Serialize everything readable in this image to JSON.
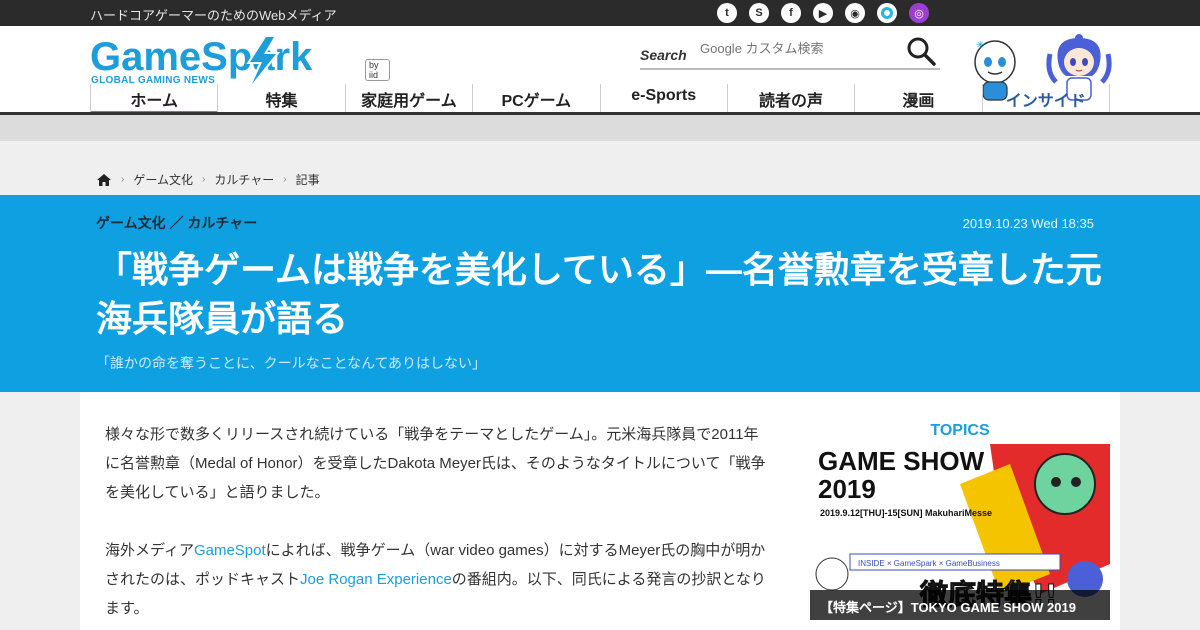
{
  "topbar": {
    "tagline": "ハードコアゲーマーのためのWebメディア",
    "social": [
      {
        "name": "twitter-icon",
        "glyph": "t"
      },
      {
        "name": "steam-icon",
        "glyph": "S"
      },
      {
        "name": "facebook-icon",
        "glyph": "f"
      },
      {
        "name": "youtube-icon",
        "glyph": "▶"
      },
      {
        "name": "rss-icon",
        "glyph": "◉"
      },
      {
        "name": "alexa-icon",
        "glyph": ""
      },
      {
        "name": "podcast-icon",
        "glyph": "◎"
      }
    ]
  },
  "logo": {
    "word": "GameSpark",
    "sub": "GLOBAL GAMING NEWS",
    "byline": "by iid"
  },
  "search": {
    "label": "Search",
    "placeholder": "Google カスタム検索"
  },
  "nav": [
    {
      "label": "ホーム",
      "active": true
    },
    {
      "label": "特集",
      "active": false
    },
    {
      "label": "家庭用ゲーム",
      "active": false
    },
    {
      "label": "PCゲーム",
      "active": false
    },
    {
      "label": "e-Sports",
      "active": false
    },
    {
      "label": "読者の声",
      "active": false
    },
    {
      "label": "漫画",
      "active": false
    },
    {
      "label": "インサイド",
      "active": false
    }
  ],
  "breadcrumb": [
    "ゲーム文化",
    "カルチャー",
    "記事"
  ],
  "hero": {
    "categories": "ゲーム文化 ／ カルチャー",
    "date": "2019.10.23 Wed 18:35",
    "title": "「戦争ゲームは戦争を美化している」―名誉勲章を受章した元海兵隊員が語る",
    "subtitle": "「誰かの命を奪うことに、クールなことなんてありはしない」"
  },
  "article": {
    "p1": "様々な形で数多くリリースされ続けている「戦争をテーマとしたゲーム」。元米海兵隊員で2011年に名誉勲章（Medal of Honor）を受章したDakota Meyer氏は、そのようなタイトルについて「戦争を美化している」と語りました。",
    "p2_a": "海外メディア",
    "p2_link1": "GameSpot",
    "p2_b": "によれば、戦争ゲーム（war video games）に対するMeyer氏の胸中が明かされたのは、ポッドキャスト",
    "p2_link2": "Joe Rogan Experience",
    "p2_c": "の番組内。以下、同氏による発言の抄訳となります。"
  },
  "topics": {
    "title": "TOPICS",
    "banner_heading_1": "GAME SHOW",
    "banner_heading_2": "2019",
    "banner_dates": "2019.9.12[THU]-15[SUN]  MakuhariMesse",
    "banner_partners": "INSIDE × GameSpark × GameBusiness",
    "banner_big": "徹底特集!!",
    "caption": "【特集ページ】TOKYO GAME SHOW 2019"
  },
  "colors": {
    "accent": "#0fa0e2",
    "logo": "#1d9dd9",
    "topbar": "#2b2b2b"
  }
}
